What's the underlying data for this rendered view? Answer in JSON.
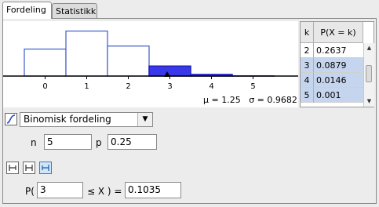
{
  "tabs": [
    {
      "label": "Fordeling",
      "active": true
    },
    {
      "label": "Statistikk",
      "active": false
    }
  ],
  "chart": {
    "axis_labels": [
      "0",
      "1",
      "2",
      "3",
      "4",
      "5"
    ],
    "mu_text": "μ = 1.25",
    "sigma_text": "σ = 0.9682"
  },
  "chart_data": {
    "type": "bar",
    "categories": [
      "0",
      "1",
      "2",
      "3",
      "4",
      "5"
    ],
    "values": [
      0.2373,
      0.3955,
      0.2637,
      0.0879,
      0.0146,
      0.001
    ],
    "highlighted": [
      "3",
      "4",
      "5"
    ]
  },
  "table": {
    "header_k": "k",
    "header_p": "P(X = k)",
    "rows": [
      {
        "k": "2",
        "p": "0.2637"
      },
      {
        "k": "3",
        "p": "0.0879"
      },
      {
        "k": "4",
        "p": "0.0146"
      },
      {
        "k": "5",
        "p": "0.001"
      }
    ]
  },
  "distribution": {
    "selected": "Binomisk fordeling",
    "icon": "distribution-curve-icon"
  },
  "params": {
    "n_label": "n",
    "n_value": "5",
    "p_label": "p",
    "p_value": "0.25"
  },
  "probability": {
    "prefix": "P(",
    "lower_value": "3",
    "operator": "≤ X ) =",
    "result": "0.1035"
  },
  "icons": {
    "left_sided": "left-sided-icon",
    "interval": "interval-icon",
    "right_sided": "right-sided-icon"
  },
  "colors": {
    "bar_outline": "#3b5bc8",
    "highlight_fill": "#3838e8",
    "selection": "#c6d5ee"
  }
}
